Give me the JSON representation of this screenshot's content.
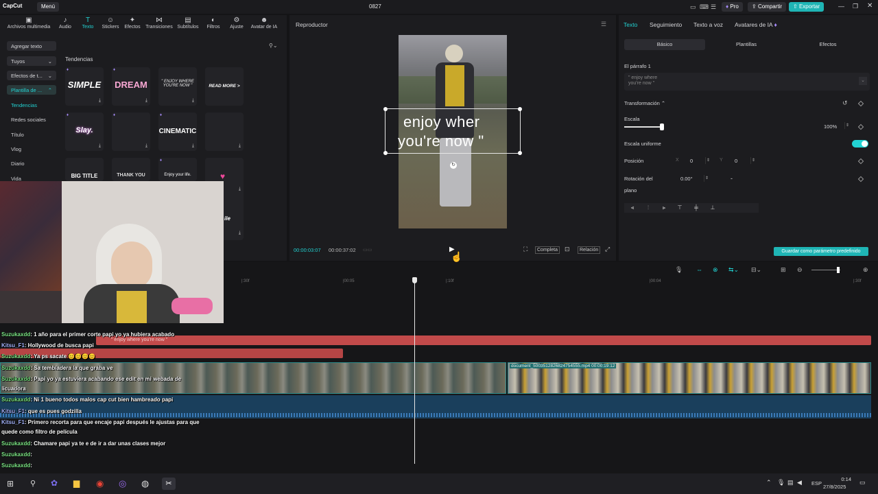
{
  "app": {
    "logo": "CapCut",
    "menu_label": "Menú",
    "project_name": "0827",
    "pro_label": "Pro",
    "share_label": "Compartir",
    "export_label": "Exportar"
  },
  "left_tools": [
    {
      "label": "Archivos multimedia",
      "icon": "media-icon"
    },
    {
      "label": "Audio",
      "icon": "audio-icon"
    },
    {
      "label": "Texto",
      "icon": "text-icon"
    },
    {
      "label": "Stickers",
      "icon": "sticker-icon"
    },
    {
      "label": "Efectos",
      "icon": "effects-icon"
    },
    {
      "label": "Transiciones",
      "icon": "transition-icon"
    },
    {
      "label": "Subtítulos",
      "icon": "subtitle-icon"
    },
    {
      "label": "Filtros",
      "icon": "filter-icon"
    },
    {
      "label": "Ajuste",
      "icon": "adjust-icon"
    },
    {
      "label": "Avatar de IA",
      "icon": "ai-avatar-icon"
    }
  ],
  "text_sidebar": {
    "add_text": "Agregar texto",
    "yours": "Tuyos",
    "text_effects": "Efectos de t...",
    "templates": "Plantilla de ...",
    "items": [
      "Tendencias",
      "Redes sociales",
      "Título",
      "Vlog",
      "Diario",
      "Vida"
    ]
  },
  "gallery": {
    "section_title": "Tendencias",
    "cards": [
      {
        "text": "SIMPLE"
      },
      {
        "text": "DREAM"
      },
      {
        "text": "\" ENJOY WHERE YOU'RE NOW \""
      },
      {
        "text": "READ MORE >"
      },
      {
        "text": "Slay."
      },
      {
        "text": ""
      },
      {
        "text": "CINEMATIC"
      },
      {
        "text": ""
      },
      {
        "text": "BIG TITLE"
      },
      {
        "text": "THANK YOU"
      },
      {
        "text": "Enjoy your life."
      },
      {
        "text": ""
      }
    ]
  },
  "player": {
    "title": "Reproductor",
    "overlay_line1": "enjoy wher",
    "overlay_line2": "you're now \"",
    "current_time": "00:00:03:07",
    "total_time": "00:00:37:02",
    "full_label": "Completa",
    "ratio_label": "Relación"
  },
  "props": {
    "tabs": [
      "Texto",
      "Seguimiento",
      "Texto a voz",
      "Avatares de IA"
    ],
    "subtabs": [
      "Básico",
      "Plantillas",
      "Efectos"
    ],
    "paragraph_label": "El párrafo 1",
    "paragraph_text": "\" enjoy where you're now \"",
    "transform_label": "Transformación",
    "scale_label": "Escala",
    "scale_value": "100%",
    "scale_fraction": 1.0,
    "uniform_label": "Escala uniforme",
    "position_label": "Posición",
    "pos_x_label": "X",
    "pos_x": "0",
    "pos_y_label": "Y",
    "pos_y": "0",
    "rotation_label": "Rotación del",
    "rotation_label2": "plano",
    "rotation_value": "0.00°",
    "rotation_dash": "-",
    "save_default": "Guardar como parámetro predefinido"
  },
  "timeline": {
    "ruler": [
      "|:30f",
      "|00:05",
      "|:10f",
      "|00:04",
      "|:30f"
    ],
    "text_clip": "\" enjoy where you're now \"",
    "video_clip": "document_5003512826824754555.mp4   00:00:19:12"
  },
  "chat": [
    {
      "user": "Suzukaxdd",
      "user_class": "u1",
      "msg": ": 1 año para el primer corte papi yo ya hubiera acabado"
    },
    {
      "user": "Kitsu_F1",
      "user_class": "u2",
      "msg": ": Hollywood de busca papi"
    },
    {
      "user": "Suzukaxdd",
      "user_class": "u1",
      "msg": ": Ya ps sacate 😊😊😊😊"
    },
    {
      "user": "Suzukaxdd",
      "user_class": "u1",
      "msg": ": Sa tembladera la que graba ve"
    },
    {
      "user": "Suzukaxdd",
      "user_class": "u1",
      "msg": ": Papi yo ya estuviera acabando ese edit en mi webada de"
    },
    {
      "user": "",
      "user_class": "u1",
      "msg": "licuadora"
    },
    {
      "user": "Suzukaxdd",
      "user_class": "u1",
      "msg": ": Ni 1 bueno todos malos cap cut bien hambreado papi"
    },
    {
      "user": "Kitsu_F1",
      "user_class": "u2",
      "msg": ": que es pues godzilla"
    },
    {
      "user": "Kitsu_F1",
      "user_class": "u2",
      "msg": ": Primero recorta para que encaje papi después le ajustas para que"
    },
    {
      "user": "",
      "user_class": "u2",
      "msg": "quede como filtro de película"
    },
    {
      "user": "Suzukaxdd",
      "user_class": "u1",
      "msg": ": Chamare papi ya te e de ir a dar unas clases mejor"
    },
    {
      "user": "Suzukaxdd",
      "user_class": "u1",
      "msg": ":"
    },
    {
      "user": "Suzukaxdd",
      "user_class": "u1",
      "msg": ":"
    },
    {
      "user": "Suzukaxdd",
      "user_class": "u1",
      "msg": ":"
    },
    {
      "user": "Suzukaxdd",
      "user_class": "u1",
      "msg": ":"
    }
  ],
  "taskbar": {
    "lang": "ESP",
    "time": "0:14",
    "date": "27/8/2025"
  },
  "colors": {
    "accent": "#22d3d3",
    "text_track": "#c24a4a",
    "video_track": "#2a8a8a",
    "audio_track": "#1f5a8a",
    "export_bg": "#1fb5b5"
  }
}
